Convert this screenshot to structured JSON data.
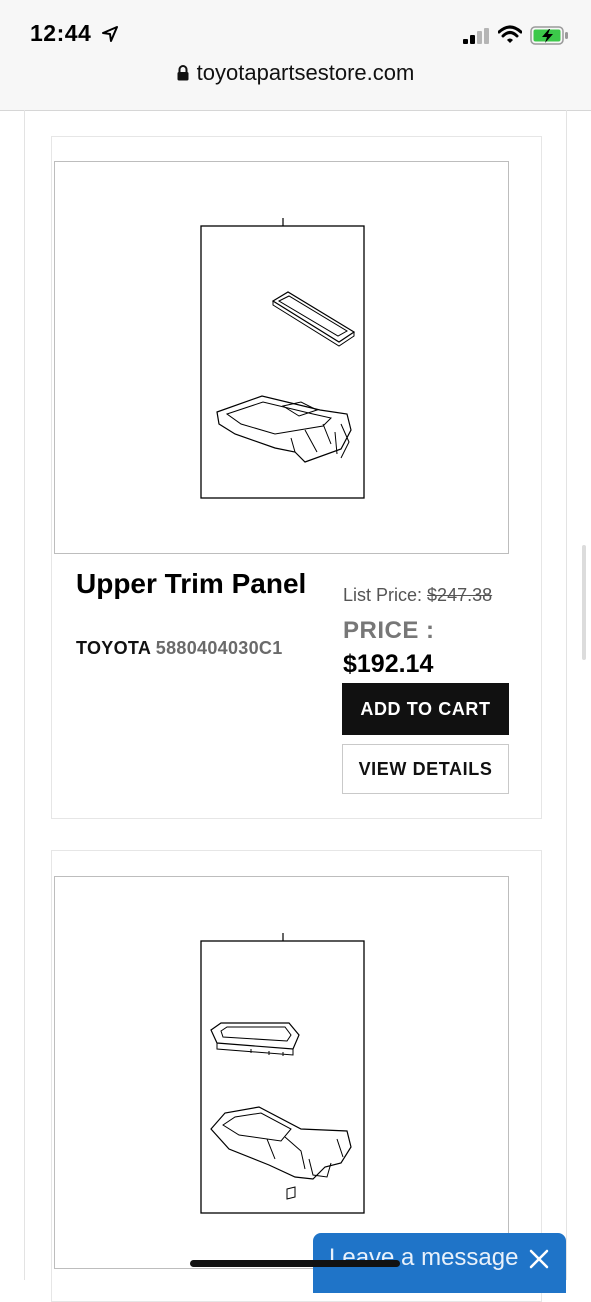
{
  "status_bar": {
    "time": "12:44"
  },
  "browser": {
    "url": "toyotapartsestore.com"
  },
  "products": [
    {
      "title": "Upper Trim Panel",
      "brand": "TOYOTA",
      "part_number": "5880404030C1",
      "list_price_label": "List Price:",
      "list_price": "$247.38",
      "price_label": "PRICE :",
      "price": "$192.14",
      "add_to_cart_label": "ADD TO CART",
      "view_details_label": "VIEW DETAILS"
    }
  ],
  "chat_widget": {
    "label": "Leave a message"
  },
  "colors": {
    "chat_blue": "#1f74c8",
    "button_black": "#111111",
    "battery_green": "#3cc94a"
  },
  "icons": [
    "location-arrow-icon",
    "signal-icon",
    "wifi-icon",
    "battery-charging-icon",
    "lock-icon",
    "close-icon"
  ]
}
